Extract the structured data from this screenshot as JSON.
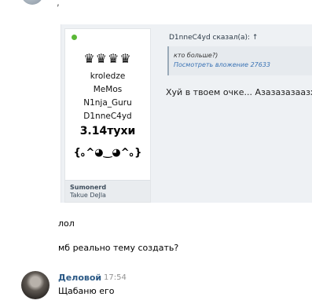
{
  "top": {
    "fragment": ","
  },
  "post": {
    "profile": {
      "crowns": "♛♛♛♛",
      "names": [
        "kroledze",
        "MeMos",
        "N1nja_Guru",
        "D1nneC4yd"
      ],
      "title": "3.14тухи",
      "kaomoji": "{｡^◕‿◕^｡}",
      "nickname": "Sumonerd",
      "subtitle": "Takue DeJla"
    },
    "quote": {
      "header": "D1nneC4yd сказал(а): ↑",
      "text": "кто больше?)",
      "link": "Посмотреть вложение 27633"
    },
    "text": "Хуй в твоем очке... Азазазазаазх"
  },
  "messages": [
    {
      "text": "лол"
    },
    {
      "text": "мб реально тему создать?"
    }
  ],
  "last_message": {
    "author": "Деловой",
    "time": "17:54",
    "text": "Щабаню его"
  },
  "colors": {
    "link": "#2a5885",
    "online": "#5ab837"
  }
}
